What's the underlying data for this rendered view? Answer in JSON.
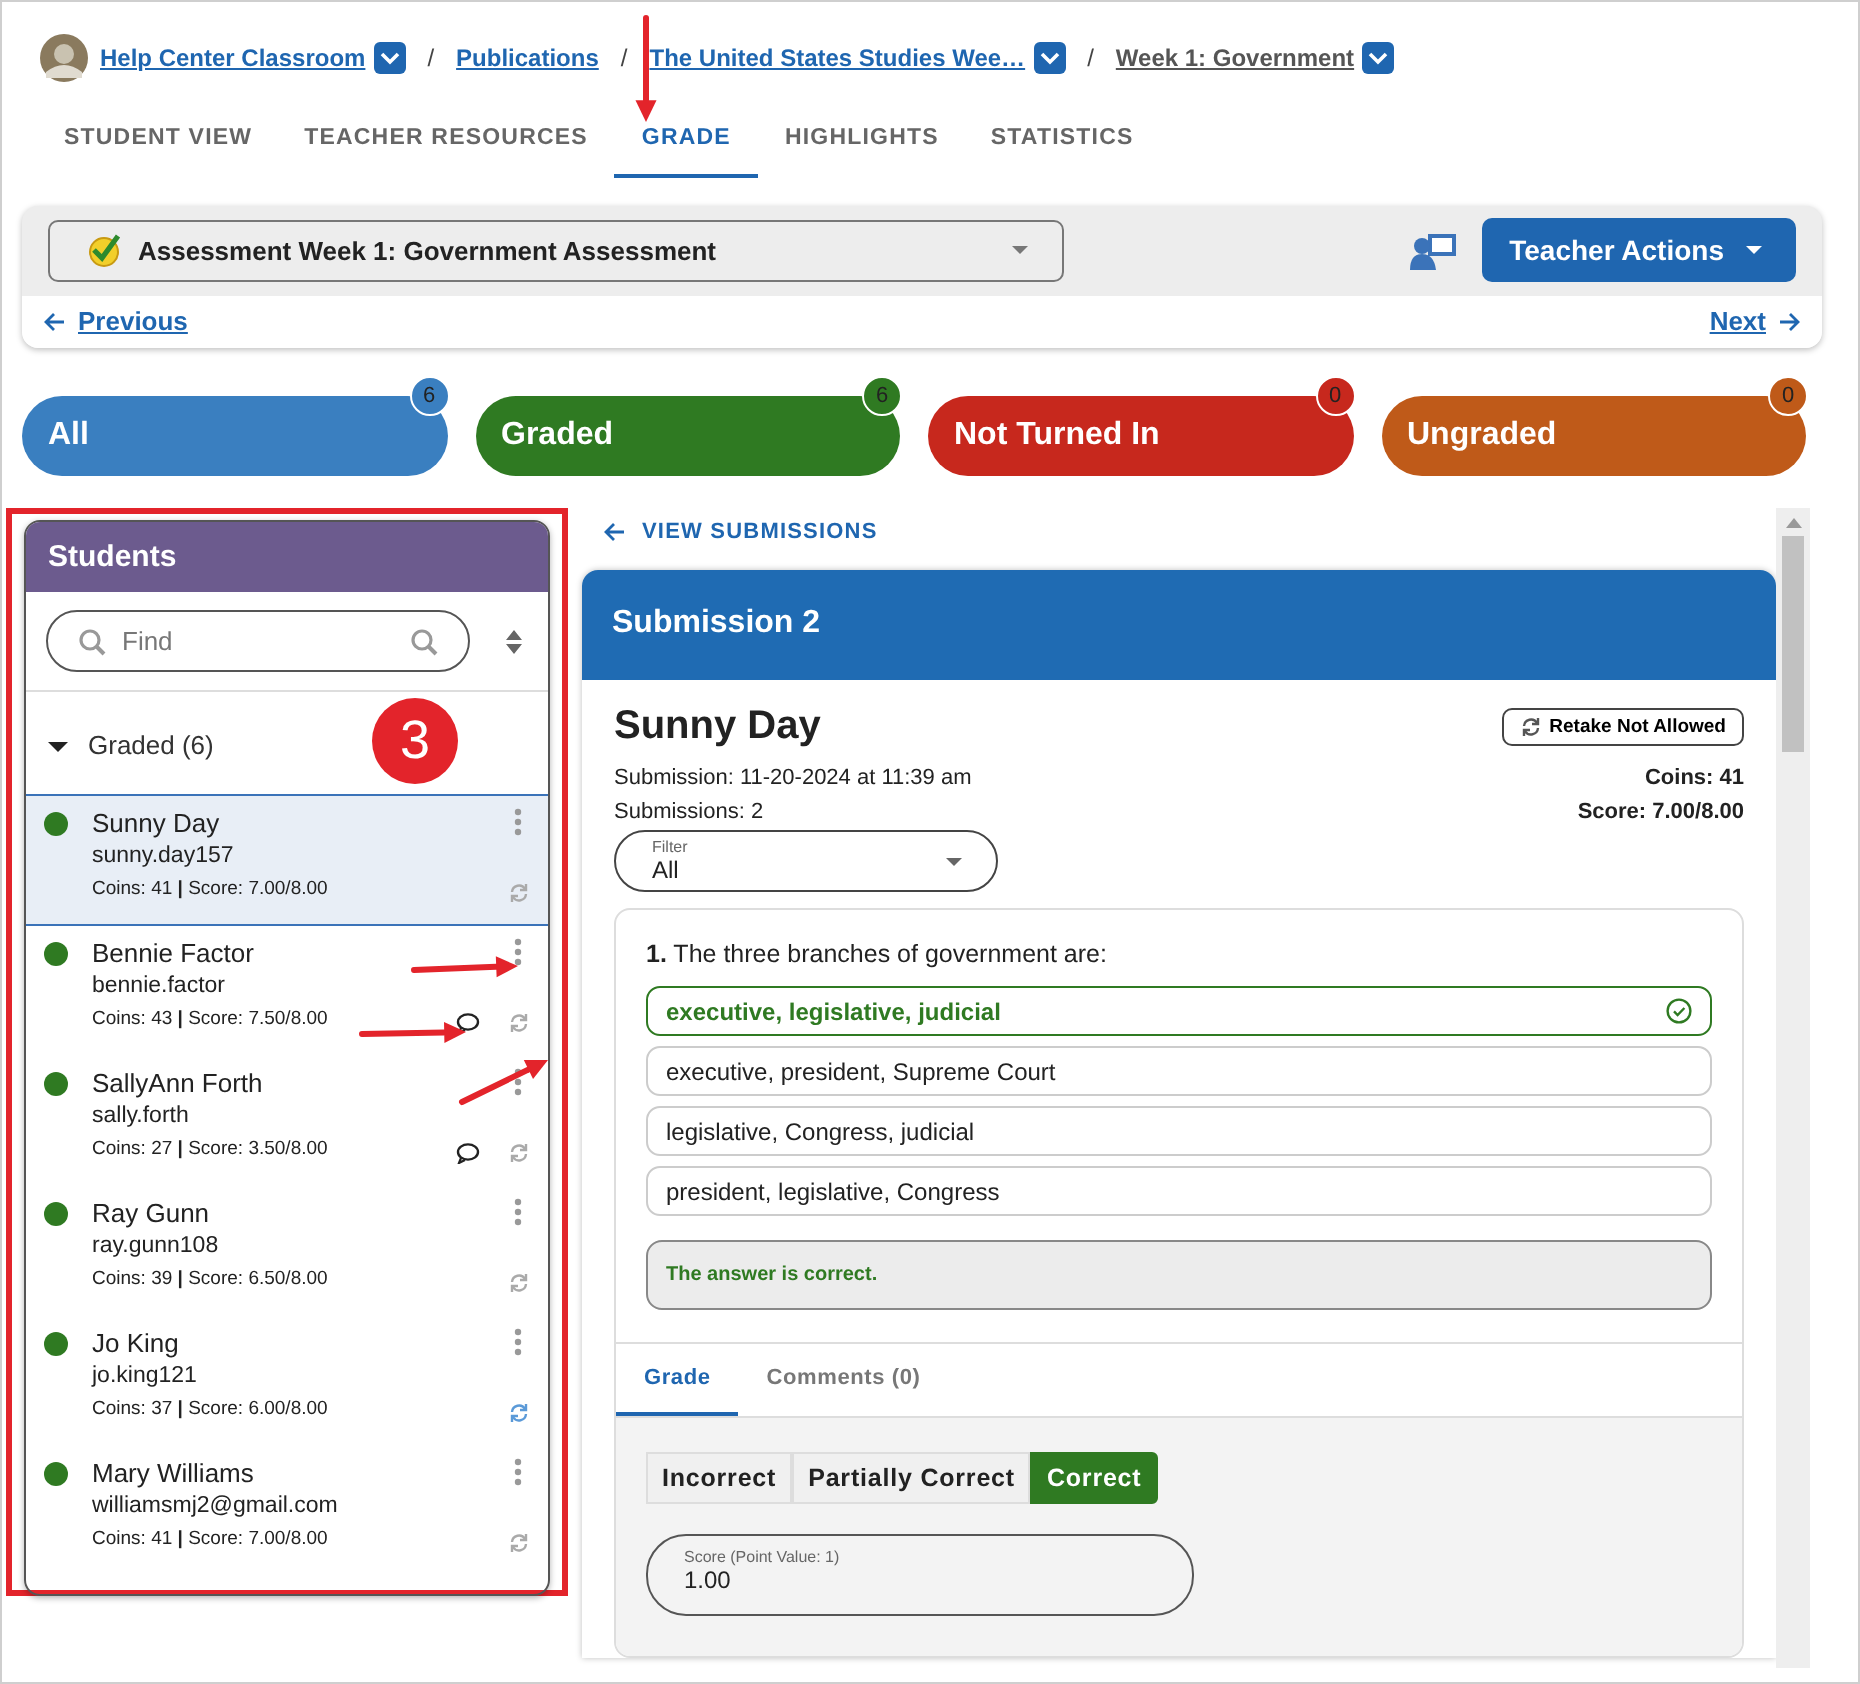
{
  "breadcrumb": [
    {
      "label": "Help Center Classroom",
      "dropdown": true,
      "current": false
    },
    {
      "separator": "/",
      "label": "Publications",
      "dropdown": false,
      "current": false
    },
    {
      "separator": "/",
      "label": "The United States Studies Wee…",
      "dropdown": true,
      "current": false
    },
    {
      "separator": "/",
      "label": "Week 1: Government",
      "dropdown": true,
      "current": true
    }
  ],
  "tabs": [
    {
      "label": "STUDENT VIEW",
      "selected": false
    },
    {
      "label": "TEACHER RESOURCES",
      "selected": false
    },
    {
      "label": "GRADE",
      "selected": true
    },
    {
      "label": "HIGHLIGHTS",
      "selected": false
    },
    {
      "label": "STATISTICS",
      "selected": false
    }
  ],
  "assessment_select": {
    "value": "Assessment Week 1: Government Assessment"
  },
  "teacher_actions": "Teacher Actions",
  "nav": {
    "previous": "Previous",
    "next": "Next"
  },
  "filters": [
    {
      "label": "All",
      "count": "6",
      "color": "#3a7fc0"
    },
    {
      "label": "Graded",
      "count": "6",
      "color": "#2f7a22"
    },
    {
      "label": "Not Turned In",
      "count": "0",
      "color": "#c7281d"
    },
    {
      "label": "Ungraded",
      "count": "0",
      "color": "#bf5a19"
    }
  ],
  "students_panel": {
    "title": "Students",
    "search_placeholder": "Find",
    "group": {
      "label": "Graded (6)",
      "expanded": true,
      "students": [
        {
          "name": "Sunny Day",
          "username": "sunny.day157",
          "stats": "Coins: 41 **|** Score: 7.00/8.00",
          "selected": true,
          "has_comment": false,
          "sync_active": false
        },
        {
          "name": "Bennie Factor",
          "username": "bennie.factor",
          "stats": "Coins: 43 **|** Score: 7.50/8.00",
          "selected": false,
          "has_comment": true,
          "sync_active": false
        },
        {
          "name": "SallyAnn Forth",
          "username": "sally.forth",
          "stats": "Coins: 27 **|** Score: 3.50/8.00",
          "selected": false,
          "has_comment": true,
          "sync_active": false
        },
        {
          "name": "Ray Gunn",
          "username": "ray.gunn108",
          "stats": "Coins: 39 **|** Score: 6.50/8.00",
          "selected": false,
          "has_comment": false,
          "sync_active": false
        },
        {
          "name": "Jo King",
          "username": "jo.king121",
          "stats": "Coins: 37 **|** Score: 6.00/8.00",
          "selected": false,
          "has_comment": false,
          "sync_active": true
        },
        {
          "name": "Mary Williams",
          "username": "williamsmj2@gmail.com",
          "stats": "Coins: 41 **|** Score: 7.00/8.00",
          "selected": false,
          "has_comment": false,
          "sync_active": false
        }
      ]
    }
  },
  "annotation_badge": "3",
  "submission": {
    "view_link": "VIEW SUBMISSIONS",
    "title": "Submission 2",
    "student": "Sunny Day",
    "retake": "Retake Not Allowed",
    "date": "Submission: 11-20-2024 at 11:39 am",
    "count": "Submissions: 2",
    "coins": "Coins: 41",
    "score": "Score: 7.00/8.00",
    "filter": {
      "label": "Filter",
      "value": "All"
    },
    "question": {
      "text": "**1.** The three branches of government are:",
      "options": [
        {
          "text": "executive, legislative, judicial",
          "correct": true
        },
        {
          "text": "executive, president, Supreme Court",
          "correct": false
        },
        {
          "text": "legislative, Congress, judicial",
          "correct": false
        },
        {
          "text": "president, legislative, Congress",
          "correct": false
        }
      ],
      "feedback": "The answer is correct."
    },
    "grade_tabs": [
      {
        "label": "Grade",
        "selected": true
      },
      {
        "label": "Comments (0)",
        "selected": false
      }
    ],
    "grade_options": [
      {
        "label": "Incorrect",
        "selected": false
      },
      {
        "label": "Partially Correct",
        "selected": false
      },
      {
        "label": "Correct",
        "selected": true
      }
    ],
    "score_field": {
      "label": "Score (Point Value: 1)",
      "value": "1.00"
    }
  }
}
